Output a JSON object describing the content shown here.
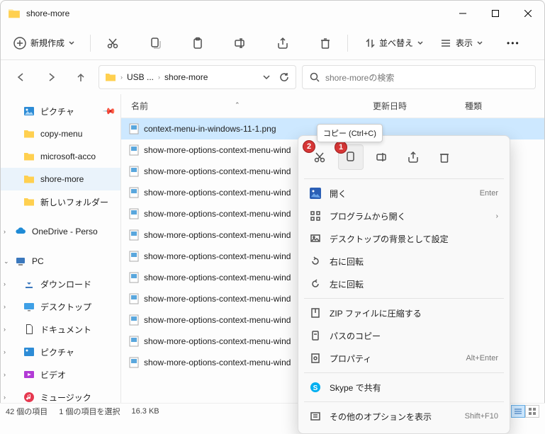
{
  "window": {
    "title": "shore-more"
  },
  "toolbar": {
    "new": "新規作成",
    "sort": "並べ替え",
    "view": "表示"
  },
  "breadcrumb": {
    "seg1": "USB ...",
    "seg2": "shore-more"
  },
  "search": {
    "placeholder": "shore-moreの検索"
  },
  "columns": {
    "name": "名前",
    "date": "更新日時",
    "type": "種類"
  },
  "sidebar": {
    "pictures": "ピクチャ",
    "copymenu": "copy-menu",
    "msacco": "microsoft-acco",
    "shoremore": "shore-more",
    "newfolder": "新しいフォルダー",
    "onedrive": "OneDrive - Perso",
    "pc": "PC",
    "downloads": "ダウンロード",
    "desktop": "デスクトップ",
    "documents": "ドキュメント",
    "pictures2": "ピクチャ",
    "videos": "ビデオ",
    "music": "ミュージック"
  },
  "files": [
    {
      "name": "context-menu-in-windows-11-1.png",
      "date": "",
      "type": ""
    },
    {
      "name": "show-more-options-context-menu-wind",
      "date": "",
      "type": ""
    },
    {
      "name": "show-more-options-context-menu-wind",
      "date": "",
      "type": ""
    },
    {
      "name": "show-more-options-context-menu-wind",
      "date": "",
      "type": ""
    },
    {
      "name": "show-more-options-context-menu-wind",
      "date": "",
      "type": ""
    },
    {
      "name": "show-more-options-context-menu-wind",
      "date": "",
      "type": ""
    },
    {
      "name": "show-more-options-context-menu-wind",
      "date": "",
      "type": ""
    },
    {
      "name": "show-more-options-context-menu-wind",
      "date": "",
      "type": ""
    },
    {
      "name": "show-more-options-context-menu-wind",
      "date": "",
      "type": ""
    },
    {
      "name": "show-more-options-context-menu-wind",
      "date": "",
      "type": ""
    },
    {
      "name": "show-more-options-context-menu-wind",
      "date": "",
      "type": ""
    },
    {
      "name": "show-more-options-context-menu-wind",
      "date": "",
      "type": ""
    }
  ],
  "context": {
    "tooltip": "コピー (Ctrl+C)",
    "open": "開く",
    "openwith": "プログラムから開く",
    "setbg": "デスクトップの背景として設定",
    "rotr": "右に回転",
    "rotl": "左に回転",
    "zip": "ZIP ファイルに圧縮する",
    "copypath": "パスのコピー",
    "props": "プロパティ",
    "skype": "Skype で共有",
    "moreopts": "その他のオプションを表示",
    "sc_open": "Enter",
    "sc_props": "Alt+Enter",
    "sc_more": "Shift+F10"
  },
  "badges": {
    "b1": "1",
    "b2": "2"
  },
  "status": {
    "count": "42 個の項目",
    "selected": "1 個の項目を選択",
    "size": "16.3 KB"
  }
}
